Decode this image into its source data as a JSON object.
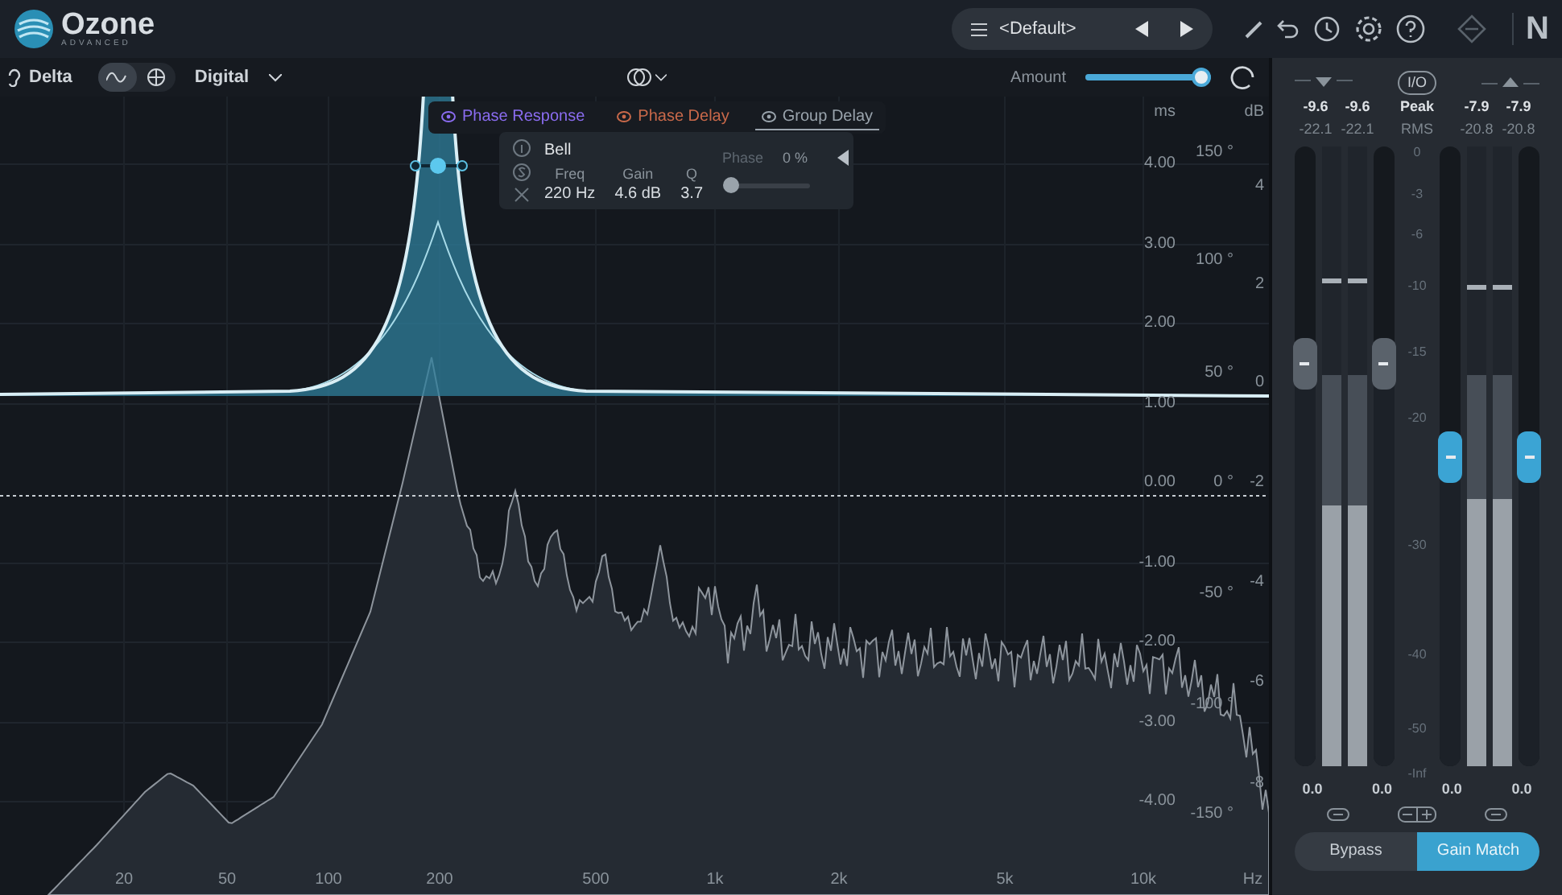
{
  "header": {
    "logo": {
      "name": "Ozone",
      "edition": "ADVANCED"
    },
    "preset": "<Default>",
    "brand": "N"
  },
  "toolbar": {
    "delta": "Delta",
    "view_modes": [
      {
        "kind": "wave",
        "selected": true
      },
      {
        "kind": "globe",
        "selected": false
      }
    ],
    "mode": "Digital",
    "amount": {
      "label": "Amount",
      "level": 1.0
    }
  },
  "legend": [
    {
      "label": "Phase Response",
      "color": "#8a6cf0",
      "selected": false
    },
    {
      "label": "Phase Delay",
      "color": "#c9694a",
      "selected": false
    },
    {
      "label": "Group Delay",
      "color": "#9aa4ad",
      "selected": true
    }
  ],
  "band_popup": {
    "shape": "Bell",
    "params": [
      {
        "label": "Freq",
        "value": "220 Hz"
      },
      {
        "label": "Gain",
        "value": "4.6 dB"
      },
      {
        "label": "Q",
        "value": "3.7"
      }
    ],
    "phase": {
      "label": "Phase",
      "value": "0 %",
      "level": 0
    }
  },
  "axes": {
    "ms": [
      "ms",
      "4.00",
      "3.00",
      "2.00",
      "1.00",
      "0.00",
      "-1.00",
      "-2.00",
      "-3.00",
      "-4.00"
    ],
    "degrees": [
      "150 °",
      "100 °",
      "50 °",
      "0 °",
      "-50 °",
      "-100 °",
      "-150 °"
    ],
    "db": [
      "dB",
      "4",
      "2",
      "0",
      "-2",
      "-4",
      "-6",
      "-8"
    ],
    "frequency": [
      "20",
      "50",
      "100",
      "200",
      "500",
      "1k",
      "2k",
      "5k",
      "10k",
      "Hz"
    ]
  },
  "meters": {
    "io": "I/O",
    "peak_label": "Peak",
    "rms_label": "RMS",
    "scale": [
      "0",
      "-3",
      "-6",
      "-10",
      "-15",
      "-20",
      "-30",
      "-40",
      "-50",
      "-Inf"
    ],
    "sections": [
      {
        "kind": "input",
        "peak": [
          "-9.6",
          "-9.6"
        ],
        "rms": [
          "-22.1",
          "-22.1"
        ],
        "faders": [
          {
            "level": 0.65,
            "value": "0.0"
          },
          {
            "level": 0.65,
            "value": "0.0"
          }
        ],
        "bars": [
          {
            "peak": {
              "level": 0.63
            },
            "rms": {
              "level": 0.42
            },
            "hold": {
              "level": 0.78
            }
          },
          {
            "peak": {
              "level": 0.63
            },
            "rms": {
              "level": 0.42
            },
            "hold": {
              "level": 0.78
            }
          }
        ]
      },
      {
        "kind": "output",
        "peak": [
          "-7.9",
          "-7.9"
        ],
        "rms": [
          "-20.8",
          "-20.8"
        ],
        "faders": [
          {
            "level": 0.5,
            "value": "0.0"
          },
          {
            "level": 0.5,
            "value": "0.0"
          }
        ],
        "bars": [
          {
            "peak": {
              "level": 0.63
            },
            "rms": {
              "level": 0.43
            },
            "hold": {
              "level": 0.77
            }
          },
          {
            "peak": {
              "level": 0.63
            },
            "rms": {
              "level": 0.43
            },
            "hold": {
              "level": 0.77
            }
          }
        ]
      }
    ]
  },
  "footer_buttons": [
    {
      "label": "Bypass",
      "selected": false
    },
    {
      "label": "Gain Match",
      "selected": true
    }
  ]
}
